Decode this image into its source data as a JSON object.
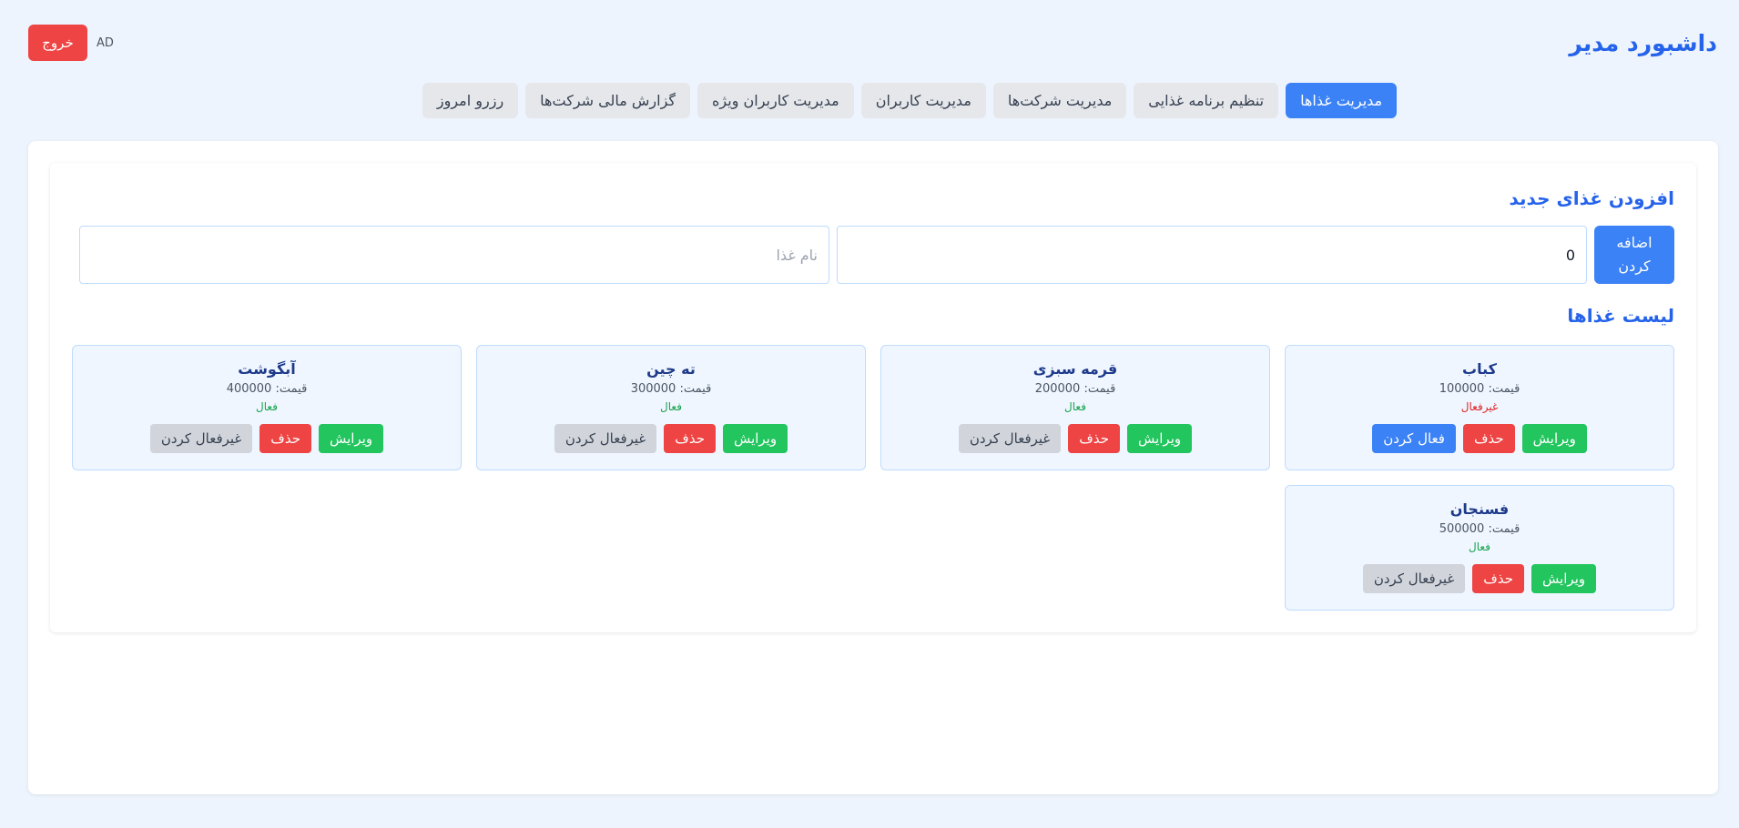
{
  "header": {
    "title": "داشبورد مدیر",
    "logout_label": "خروج",
    "user": "AD"
  },
  "nav": {
    "tabs": [
      {
        "label": "مدیریت غذاها",
        "active": true
      },
      {
        "label": "تنظیم برنامه غذایی",
        "active": false
      },
      {
        "label": "مدیریت شرکت‌ها",
        "active": false
      },
      {
        "label": "مدیریت کاربران",
        "active": false
      },
      {
        "label": "مدیریت کاربران ویژه",
        "active": false
      },
      {
        "label": "گزارش مالی شرکت‌ها",
        "active": false
      },
      {
        "label": "رزرو امروز",
        "active": false
      }
    ]
  },
  "add_food": {
    "title": "افزودن غذای جدید",
    "submit_label": "اضافه کردن",
    "price_value": "0",
    "name_placeholder": "نام غذا"
  },
  "food_list": {
    "title": "لیست غذاها",
    "price_prefix": "قیمت:",
    "labels": {
      "edit": "ویرایش",
      "delete": "حذف",
      "deactivate": "غیرفعال کردن",
      "activate": "فعال کردن",
      "active": "فعال",
      "inactive": "غیرفعال"
    },
    "items": [
      {
        "name": "کباب",
        "price": "100000",
        "active": false
      },
      {
        "name": "قرمه سبزی",
        "price": "200000",
        "active": true
      },
      {
        "name": "ته چین",
        "price": "300000",
        "active": true
      },
      {
        "name": "آبگوشت",
        "price": "400000",
        "active": true
      },
      {
        "name": "فسنجان",
        "price": "500000",
        "active": true
      }
    ]
  },
  "colors": {
    "primary": "#3b82f6",
    "title": "#2563eb",
    "danger": "#ef4444",
    "success": "#22c55e",
    "neutral": "#d1d5db",
    "background": "#eef4fd"
  }
}
